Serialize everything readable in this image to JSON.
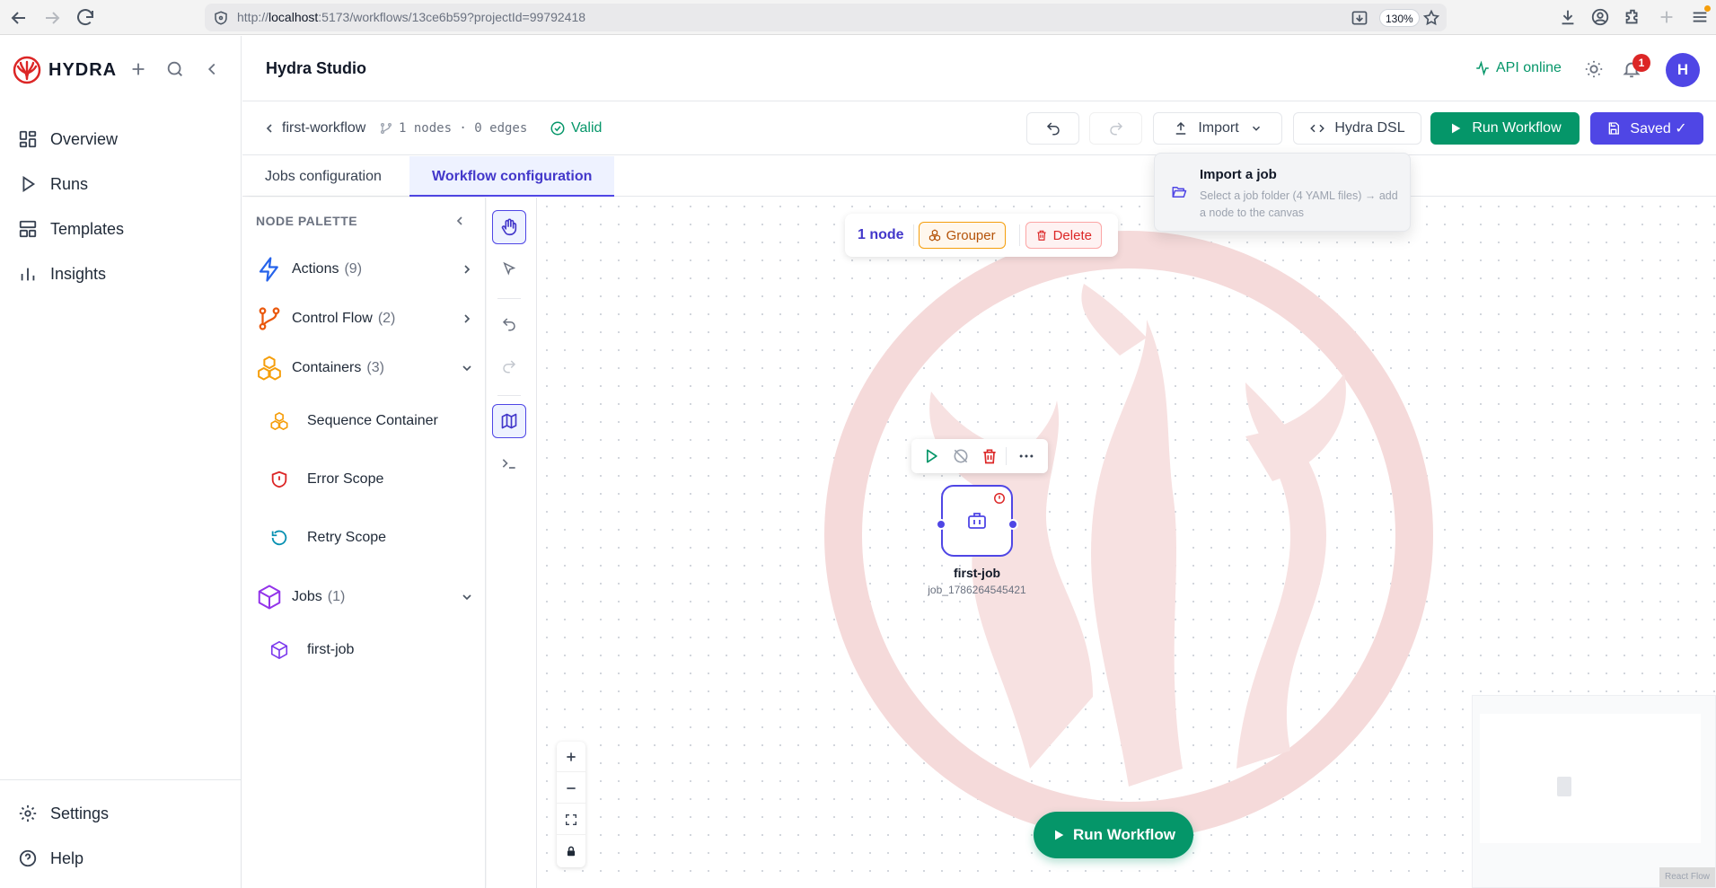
{
  "browser": {
    "url_prefix": "http://",
    "url_host": "localhost",
    "url_rest": ":5173/workflows/13ce6b59?projectId=99792418",
    "zoom": "130%"
  },
  "sidebar": {
    "brand": "HYDRA",
    "items": [
      {
        "label": "Overview",
        "icon": "grid-icon"
      },
      {
        "label": "Runs",
        "icon": "play-icon"
      },
      {
        "label": "Templates",
        "icon": "layout-icon"
      },
      {
        "label": "Insights",
        "icon": "bar-chart-icon"
      }
    ],
    "bottom": [
      {
        "label": "Settings",
        "icon": "gear-icon"
      },
      {
        "label": "Help",
        "icon": "help-icon"
      }
    ]
  },
  "header": {
    "title": "Hydra Studio",
    "api_status": "API online",
    "notifications": "1",
    "avatar": "H"
  },
  "toolbar": {
    "workflow_name": "first-workflow",
    "node_edge_count": "1 nodes · 0 edges",
    "valid_label": "Valid",
    "import_label": "Import",
    "dsl_label": "Hydra DSL",
    "run_label": "Run Workflow",
    "saved_label": "Saved ✓"
  },
  "tabs": [
    {
      "label": "Jobs configuration",
      "active": false
    },
    {
      "label": "Workflow configuration",
      "active": true
    }
  ],
  "palette": {
    "title": "NODE PALETTE",
    "categories": {
      "actions": {
        "label": "Actions",
        "count": "(9)"
      },
      "control_flow": {
        "label": "Control Flow",
        "count": "(2)"
      },
      "containers": {
        "label": "Containers",
        "count": "(3)"
      },
      "jobs": {
        "label": "Jobs",
        "count": "(1)"
      }
    },
    "container_items": [
      "Sequence Container",
      "Error Scope",
      "Retry Scope"
    ],
    "job_items": [
      "first-job"
    ]
  },
  "selection_bar": {
    "count": "1 node",
    "grouper": "Grouper",
    "delete": "Delete"
  },
  "node": {
    "label": "first-job",
    "id": "job_1786264545421"
  },
  "canvas": {
    "run_label": "Run Workflow"
  },
  "import_menu": {
    "title": "Import a job",
    "description": "Select a job folder (4 YAML files) → add a node to the canvas"
  },
  "colors": {
    "accent": "#4f46e5",
    "success": "#059669",
    "danger": "#dc2626",
    "warning": "#f59e0b"
  }
}
